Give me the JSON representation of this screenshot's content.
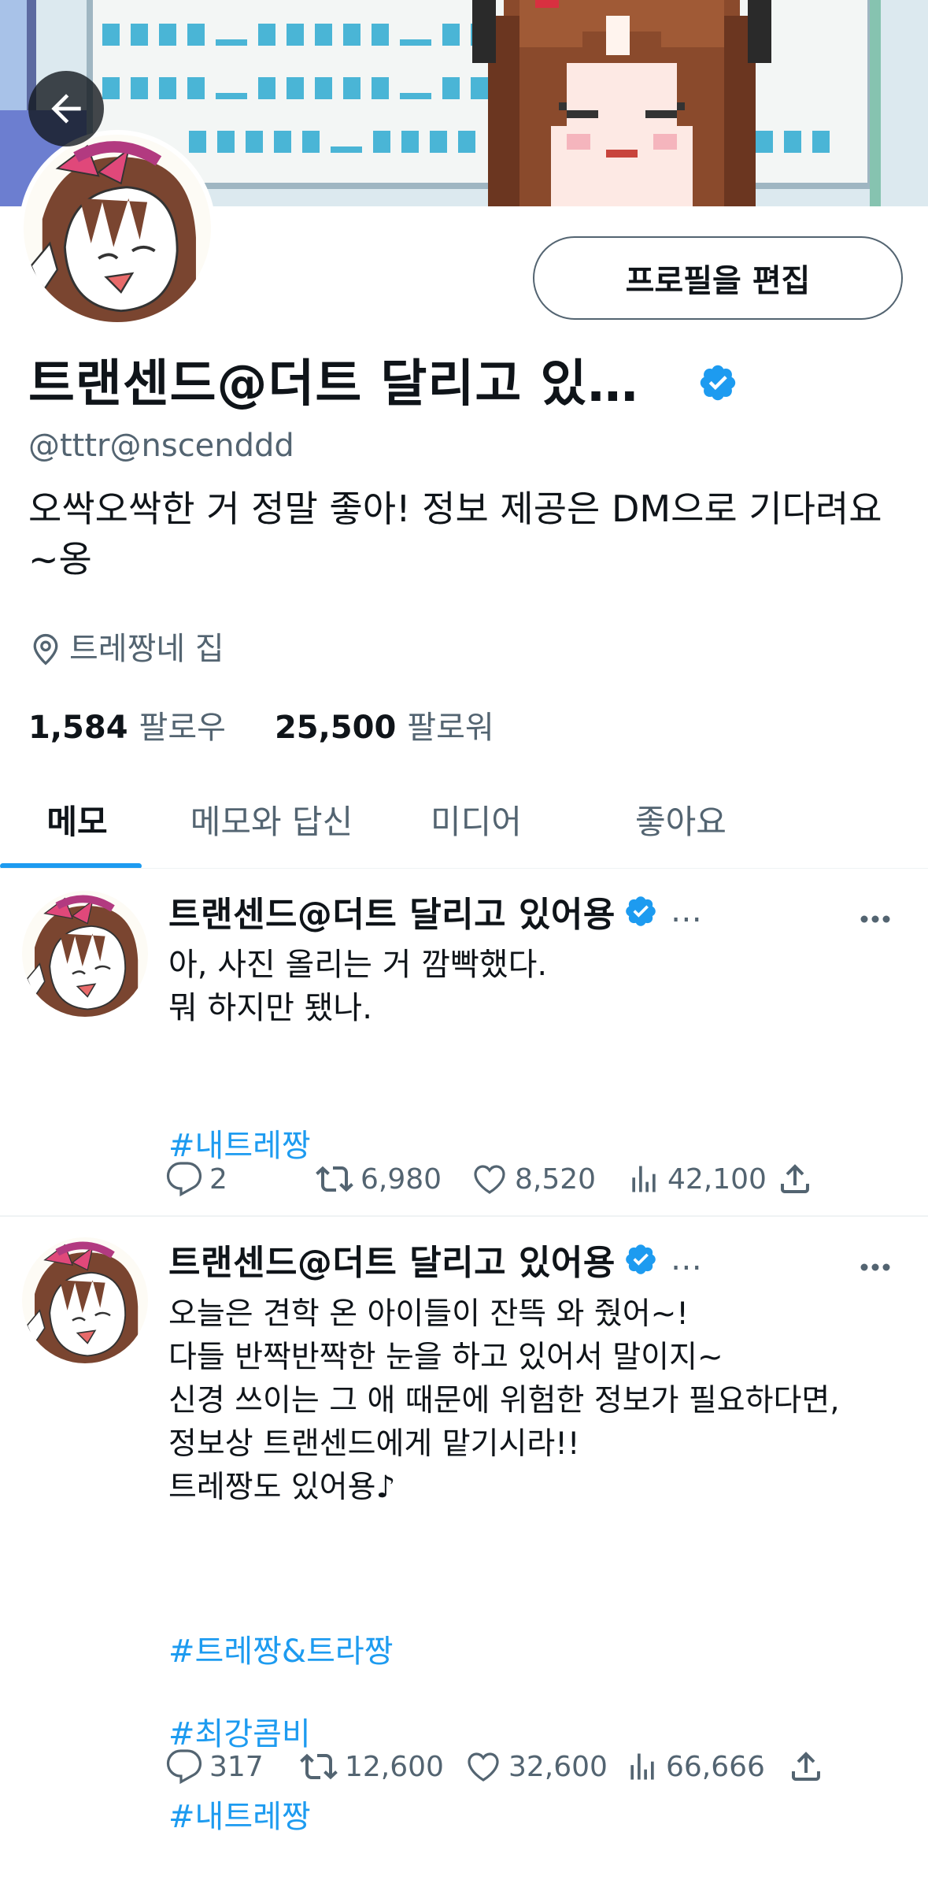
{
  "profile": {
    "display_name": "트랜센드@더트 달리고 있…",
    "handle": "@tttr@nscenddd",
    "bio": "오싹오싹한 거 정말 좋아! 정보 제공은 DM으로 기다려요~옹",
    "location": "트레짱네 집",
    "following_count": "1,584",
    "following_label": "팔로우",
    "followers_count": "25,500",
    "followers_label": "팔로워",
    "edit_button": "프로필을 편집",
    "verified": true
  },
  "tabs": [
    {
      "label": "메모",
      "active": true
    },
    {
      "label": "메모와 답신",
      "active": false
    },
    {
      "label": "미디어",
      "active": false
    },
    {
      "label": "좋아요",
      "active": false
    }
  ],
  "tweets": [
    {
      "author": "트랜센드@더트 달리고 있어용",
      "ellipsis": "…",
      "text": "아, 사진 올리는 거 깜빡했다.\n뭐 하지만 됐나.",
      "hashtags": [
        "#내트레짱"
      ],
      "replies": "2",
      "retweets": "6,980",
      "likes": "8,520",
      "views": "42,100"
    },
    {
      "author": "트랜센드@더트 달리고 있어용",
      "ellipsis": "…",
      "text": "오늘은 견학 온 아이들이 잔뜩 와 줬어~!\n다들 반짝반짝한 눈을 하고 있어서 말이지~\n신경 쓰이는 그 애 때문에 위험한 정보가 필요하다면,\n정보상 트랜센드에게 맡기시라!!\n트레짱도 있어용♪",
      "hashtags": [
        "#트레짱&트라짱",
        "#최강콤비",
        "#내트레짱"
      ],
      "replies": "317",
      "retweets": "12,600",
      "likes": "32,600",
      "views": "66,666"
    }
  ],
  "colors": {
    "accent": "#1d9bf0",
    "text": "#0f1419",
    "secondary": "#536471",
    "divider": "#eff3f4"
  },
  "icons": [
    "back-arrow-icon",
    "verified-icon",
    "location-pin-icon",
    "more-icon",
    "reply-icon",
    "retweet-icon",
    "like-icon",
    "views-icon",
    "share-icon"
  ]
}
